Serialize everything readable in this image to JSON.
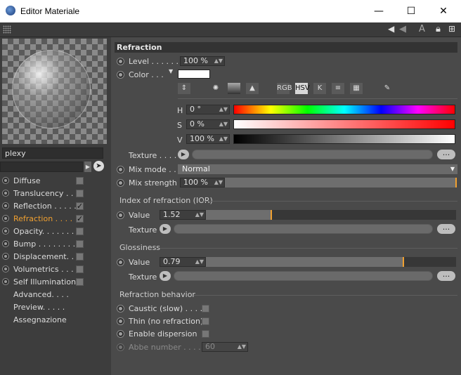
{
  "window": {
    "title": "Editor Materiale",
    "controls": {
      "minimize": "—",
      "maximize": "☐",
      "close": "✕"
    }
  },
  "left": {
    "material_name": "plexy",
    "channels": [
      {
        "label": "Diffuse",
        "checked": false
      },
      {
        "label": "Translucency . . .",
        "checked": false
      },
      {
        "label": "Reflection . . . . .",
        "checked": true
      },
      {
        "label": "Refraction . . . .",
        "checked": true
      },
      {
        "label": "Opacity. . . . . . .",
        "checked": false
      },
      {
        "label": "Bump . . . . . . . .",
        "checked": false
      },
      {
        "label": "Displacement. . .",
        "checked": false
      },
      {
        "label": "Volumetrics . . . .",
        "checked": false
      },
      {
        "label": "Self Illumination",
        "checked": false
      }
    ],
    "links": [
      "Advanced. . . .",
      "Preview. . . . .",
      "Assegnazione"
    ]
  },
  "right": {
    "section_title": "Refraction",
    "level": {
      "label": "Level . . . . . . .",
      "value": "100 %"
    },
    "color": {
      "label": "Color . . .",
      "swatch": "#ffffff"
    },
    "color_modes": [
      "RGB",
      "HSV",
      "K"
    ],
    "hsv": [
      {
        "label": "H",
        "value": "0 °"
      },
      {
        "label": "S",
        "value": "0 %"
      },
      {
        "label": "V",
        "value": "100 %"
      }
    ],
    "texture_label": "Texture . . . . .",
    "mix_mode": {
      "label": "Mix mode . . .",
      "value": "Normal"
    },
    "mix_strength": {
      "label": "Mix strength",
      "value": "100 %",
      "fraction": 1.0
    },
    "ior": {
      "title": "Index of refraction (IOR)",
      "value_label": "Value",
      "value": "1.52",
      "fraction": 0.26,
      "texture_label": "Texture"
    },
    "glossiness": {
      "title": "Glossiness",
      "value_label": "Value",
      "value": "0.79",
      "fraction": 0.79,
      "texture_label": "Texture"
    },
    "behavior": {
      "title": "Refraction behavior",
      "options": [
        {
          "label": "Caustic (slow) . . . .",
          "checked": false
        },
        {
          "label": "Thin (no refraction)",
          "checked": false
        },
        {
          "label": "Enable dispersion",
          "checked": false
        }
      ],
      "abbe": {
        "label": "Abbe number . . . .",
        "value": "60"
      }
    },
    "more_label": "..."
  }
}
